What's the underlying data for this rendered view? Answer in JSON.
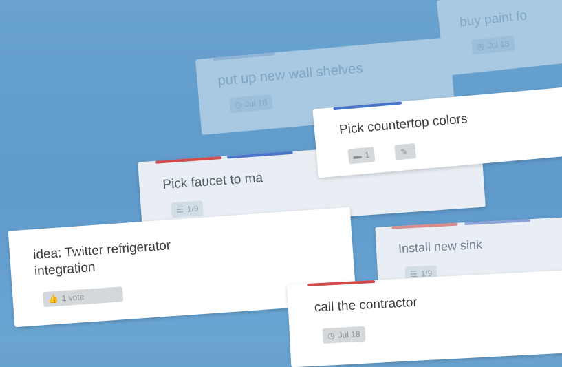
{
  "cards": [
    {
      "title": "buy paint fo",
      "badge": "Jul 18",
      "badge_icon": "clock-icon"
    },
    {
      "title": "put up new wall shelves",
      "badge": "Jul 18",
      "badge_icon": "clock-icon"
    },
    {
      "title": "Pick countertop colors",
      "comment_count": "1",
      "badge_icon": "comment-icon",
      "second_badge_icon": "pencil-icon"
    },
    {
      "title": "Pick faucet to ma",
      "badge": "1/9",
      "badge_icon": "checklist-icon"
    },
    {
      "title_line1": "idea: Twitter refrigerator",
      "title_line2": "integration",
      "badge": "1 vote",
      "badge_icon": "thumbs-up-icon"
    },
    {
      "title": "Install new sink",
      "badge": "1/9",
      "badge_icon": "checklist-icon"
    },
    {
      "title": "call the contractor",
      "badge": "Jul 18",
      "badge_icon": "clock-icon"
    }
  ],
  "colors": {
    "background": "#5f9acb",
    "label_red": "#d44a4a",
    "label_blue": "#4a74c9"
  }
}
